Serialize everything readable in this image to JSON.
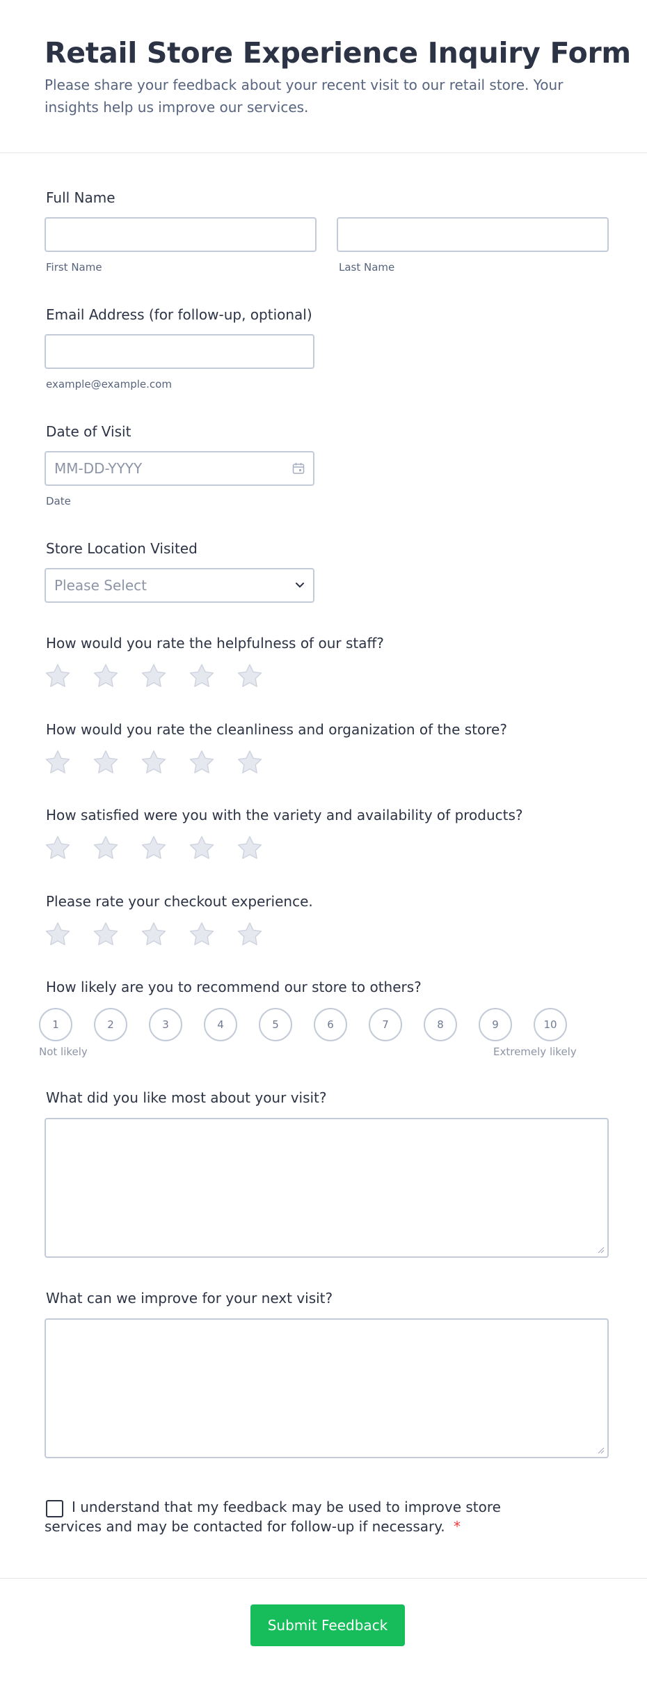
{
  "form": {
    "title": "Retail Store Experience Inquiry Form",
    "subtitle": "Please share your feedback about your recent visit to our retail store. Your insights help us improve our services."
  },
  "full_name": {
    "label": "Full Name",
    "first_sublabel": "First Name",
    "last_sublabel": "Last Name"
  },
  "email": {
    "label": "Email Address (for follow-up, optional)",
    "sublabel": "example@example.com"
  },
  "date": {
    "label": "Date of Visit",
    "placeholder": "MM-DD-YYYY",
    "sublabel": "Date",
    "icon": "calendar-icon"
  },
  "store": {
    "label": "Store Location Visited",
    "selected": "Please Select",
    "icon": "chevron-down-icon"
  },
  "ratings": [
    {
      "label": "How would you rate the helpfulness of our staff?",
      "max": 5,
      "value": 0
    },
    {
      "label": "How would you rate the cleanliness and organization of the store?",
      "max": 5,
      "value": 0
    },
    {
      "label": "How satisfied were you with the variety and availability of products?",
      "max": 5,
      "value": 0
    },
    {
      "label": "Please rate your checkout experience.",
      "max": 5,
      "value": 0
    }
  ],
  "recommend": {
    "label": "How likely are you to recommend our store to others?",
    "options": [
      "1",
      "2",
      "3",
      "4",
      "5",
      "6",
      "7",
      "8",
      "9",
      "10"
    ],
    "low_label": "Not likely",
    "high_label": "Extremely likely"
  },
  "liked": {
    "label": "What did you like most about your visit?",
    "value": ""
  },
  "improve": {
    "label": "What can we improve for your next visit?",
    "value": ""
  },
  "consent": {
    "text": "I understand that my feedback may be used to improve store services and may be contacted for follow-up if necessary.",
    "required_mark": "*",
    "checked": false
  },
  "submit": {
    "label": "Submit Feedback"
  },
  "colors": {
    "accent": "#18bd5b",
    "required": "#f23a3c",
    "text": "#2c3345",
    "muted": "#57647e",
    "border": "#c3cad8"
  }
}
